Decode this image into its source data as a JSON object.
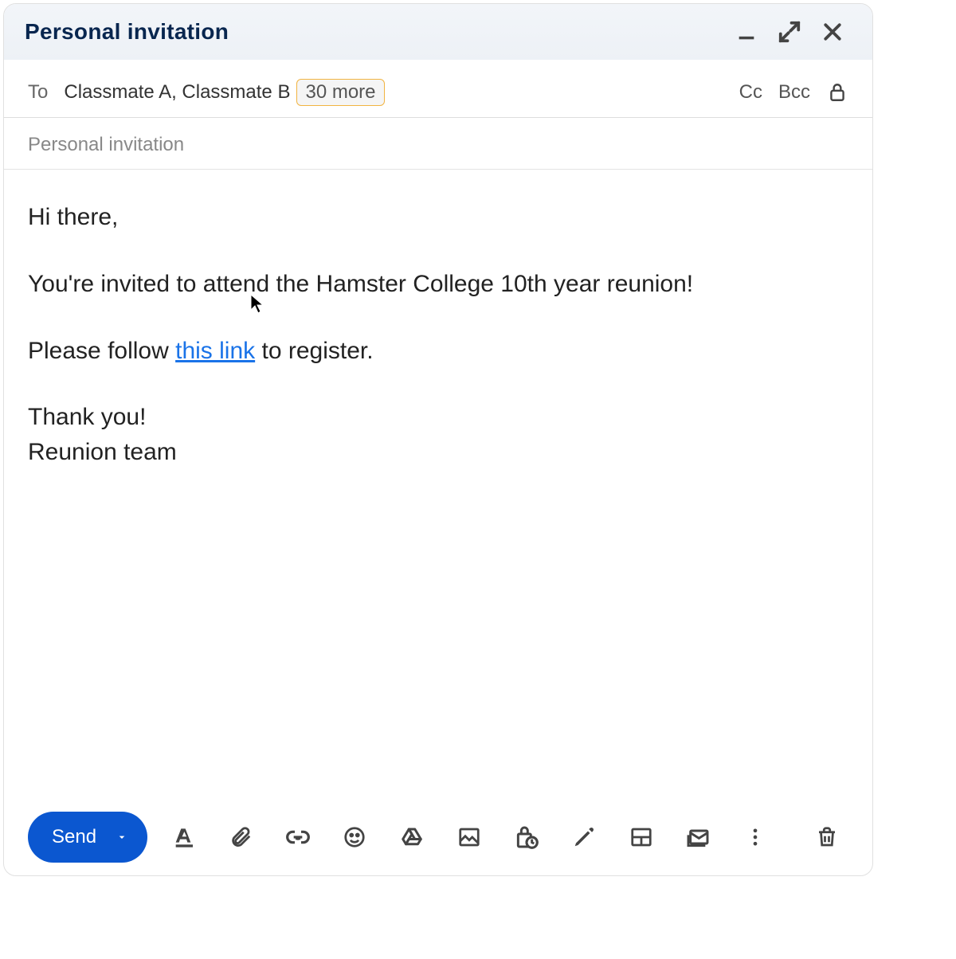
{
  "titlebar": {
    "title": "Personal invitation"
  },
  "recipients": {
    "to_label": "To",
    "shown": "Classmate A, Classmate B",
    "more": "30 more",
    "cc": "Cc",
    "bcc": "Bcc"
  },
  "subject": "Personal invitation",
  "body": {
    "greeting": "Hi there,",
    "line1": "You're invited to attend the Hamster College 10th year reunion!",
    "line2_pre": "Please follow ",
    "link_text": "this link",
    "line2_post": " to register.",
    "thanks": "Thank you!",
    "signature": "Reunion team"
  },
  "toolbar": {
    "send": "Send"
  },
  "icons": {
    "minimize": "minimize-icon",
    "fullscreen": "fullscreen-icon",
    "close": "close-icon",
    "lock": "lock-icon",
    "format": "text-format-icon",
    "attach": "attachment-icon",
    "link": "link-icon",
    "emoji": "emoji-icon",
    "drive": "drive-icon",
    "image": "image-icon",
    "confidential": "confidential-mode-icon",
    "signature": "pen-icon",
    "layout": "layout-icon",
    "mail": "mail-icon",
    "more": "more-vert-icon",
    "trash": "trash-icon"
  },
  "colors": {
    "accent": "#0b57d0",
    "link": "#1a73e8",
    "title": "#08264f",
    "chip_border": "#f1b442"
  }
}
